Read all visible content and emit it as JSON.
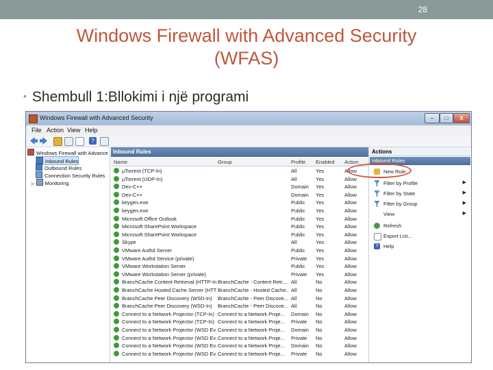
{
  "slide": {
    "number": "28",
    "title_line1": "Windows Firewall with Advanced Security",
    "title_line2": "(WFAS)",
    "bullet": "Shembull 1:Bllokimi i një programi"
  },
  "window": {
    "title": "Windows Firewall with Advanced Security",
    "buttons": {
      "minimize": "–",
      "maximize": "□",
      "close": "X"
    },
    "menu": [
      "File",
      "Action",
      "View",
      "Help"
    ]
  },
  "tree": {
    "root": "Windows Firewall with Advance",
    "items": [
      "Inbound Rules",
      "Outbound Rules",
      "Connection Security Rules",
      "Monitoring"
    ]
  },
  "center": {
    "header": "Inbound Rules",
    "columns": [
      "Name",
      "Group",
      "Profile",
      "Enabled",
      "Action"
    ],
    "rows": [
      {
        "name": "µTorrent (TCP-In)",
        "group": "",
        "profile": "All",
        "enabled": "Yes",
        "action": "Allow"
      },
      {
        "name": "µTorrent (UDP-In)",
        "group": "",
        "profile": "All",
        "enabled": "Yes",
        "action": "Allow"
      },
      {
        "name": "Dev-C++",
        "group": "",
        "profile": "Domain",
        "enabled": "Yes",
        "action": "Allow"
      },
      {
        "name": "Dev-C++",
        "group": "",
        "profile": "Domain",
        "enabled": "Yes",
        "action": "Allow"
      },
      {
        "name": "keygen.exe",
        "group": "",
        "profile": "Public",
        "enabled": "Yes",
        "action": "Allow"
      },
      {
        "name": "keygen.exe",
        "group": "",
        "profile": "Public",
        "enabled": "Yes",
        "action": "Allow"
      },
      {
        "name": "Microsoft Office Outlook",
        "group": "",
        "profile": "Public",
        "enabled": "Yes",
        "action": "Allow"
      },
      {
        "name": "Microsoft SharePoint Workspace",
        "group": "",
        "profile": "Public",
        "enabled": "Yes",
        "action": "Allow"
      },
      {
        "name": "Microsoft SharePoint Workspace",
        "group": "",
        "profile": "Public",
        "enabled": "Yes",
        "action": "Allow"
      },
      {
        "name": "Skype",
        "group": "",
        "profile": "All",
        "enabled": "Yes",
        "action": "Allow"
      },
      {
        "name": "VMware Authd Server",
        "group": "",
        "profile": "Public",
        "enabled": "Yes",
        "action": "Allow"
      },
      {
        "name": "VMware Authd Service (private)",
        "group": "",
        "profile": "Private",
        "enabled": "Yes",
        "action": "Allow"
      },
      {
        "name": "VMware Workstation Server",
        "group": "",
        "profile": "Public",
        "enabled": "Yes",
        "action": "Allow"
      },
      {
        "name": "VMware Workstation Server (private)",
        "group": "",
        "profile": "Private",
        "enabled": "Yes",
        "action": "Allow"
      },
      {
        "name": "BranchCache Content Retrieval (HTTP-In)",
        "group": "BranchCache - Content Retr...",
        "profile": "All",
        "enabled": "No",
        "action": "Allow"
      },
      {
        "name": "BranchCache Hosted Cache Server (HTT...",
        "group": "BranchCache - Hosted Cache...",
        "profile": "All",
        "enabled": "No",
        "action": "Allow"
      },
      {
        "name": "BranchCache Peer Discovery (WSD-In)",
        "group": "BranchCache - Peer Discove...",
        "profile": "All",
        "enabled": "No",
        "action": "Allow"
      },
      {
        "name": "BranchCache Peer Discovery (WSD-In)",
        "group": "BranchCache - Peer Discove...",
        "profile": "All",
        "enabled": "No",
        "action": "Allow"
      },
      {
        "name": "Connect to a Network Projector (TCP-In)",
        "group": "Connect to a Network Proje...",
        "profile": "Domain",
        "enabled": "No",
        "action": "Allow"
      },
      {
        "name": "Connect to a Network Projector (TCP-In)",
        "group": "Connect to a Network Proje...",
        "profile": "Private",
        "enabled": "No",
        "action": "Allow"
      },
      {
        "name": "Connect to a Network Projector (WSD Ev...",
        "group": "Connect to a Network Proje...",
        "profile": "Domain",
        "enabled": "No",
        "action": "Allow"
      },
      {
        "name": "Connect to a Network Projector (WSD Ev...",
        "group": "Connect to a Network Proje...",
        "profile": "Private",
        "enabled": "No",
        "action": "Allow"
      },
      {
        "name": "Connect to a Network Projector (WSD Ev...",
        "group": "Connect to a Network Proje...",
        "profile": "Domain",
        "enabled": "No",
        "action": "Allow"
      },
      {
        "name": "Connect to a Network Projector (WSD Ev...",
        "group": "Connect to a Network Proje...",
        "profile": "Private",
        "enabled": "No",
        "action": "Allow"
      }
    ]
  },
  "actions": {
    "header": "Actions",
    "section": "Inbound Rules",
    "items": [
      {
        "label": "New Rule...",
        "icon": "new-rule-icon",
        "submenu": false
      },
      {
        "label": "Filter by Profile",
        "icon": "filter-icon",
        "submenu": true
      },
      {
        "label": "Filter by State",
        "icon": "filter-icon",
        "submenu": true
      },
      {
        "label": "Filter by Group",
        "icon": "filter-icon",
        "submenu": true
      },
      {
        "label": "View",
        "icon": "",
        "submenu": true
      },
      {
        "label": "Refresh",
        "icon": "refresh-icon",
        "submenu": false
      },
      {
        "label": "Export List...",
        "icon": "export-icon",
        "submenu": false
      },
      {
        "label": "Help",
        "icon": "help-icon",
        "submenu": false
      }
    ]
  },
  "colors": {
    "accent_title": "#c0563a",
    "highlight": "#d0503a",
    "rule_allow": "#3f9a3a"
  }
}
